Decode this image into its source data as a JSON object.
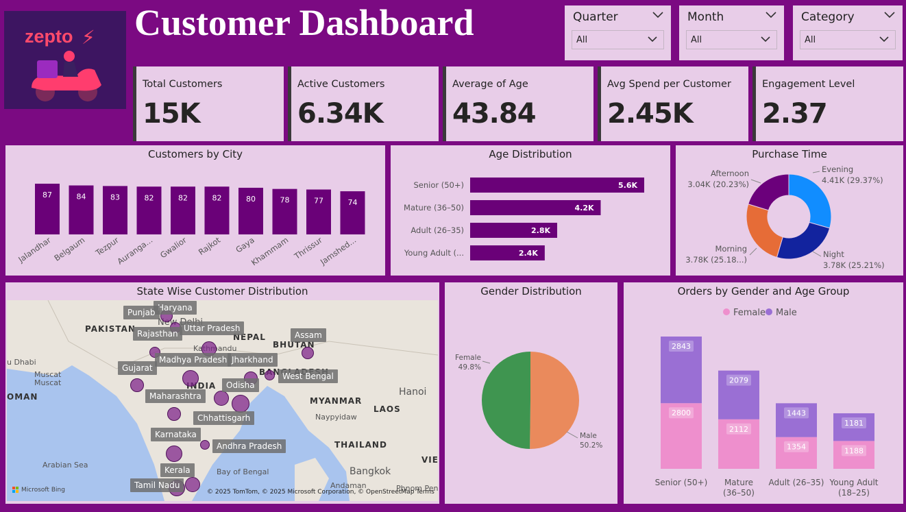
{
  "logo_text": "zepto",
  "title": "Customer Dashboard",
  "slicers": [
    {
      "label": "Quarter",
      "value": "All"
    },
    {
      "label": "Month",
      "value": "All"
    },
    {
      "label": "Category",
      "value": "All"
    }
  ],
  "kpis": [
    {
      "label": "Total Customers",
      "value": "15K"
    },
    {
      "label": "Active Customers",
      "value": "6.34K"
    },
    {
      "label": "Average of Age",
      "value": "43.84"
    },
    {
      "label": "Avg Spend per Customer",
      "value": "2.45K"
    },
    {
      "label": "Engagement Level",
      "value": "2.37"
    }
  ],
  "colors": {
    "bar": "#6a0178",
    "background": "#7b0a82",
    "panel": "#e8cde8",
    "female": "#ee8fcd",
    "male": "#9a6fd4"
  },
  "charts": {
    "city": {
      "title": "Customers by City"
    },
    "age": {
      "title": "Age Distribution"
    },
    "purchase": {
      "title": "Purchase Time"
    },
    "state": {
      "title": "State Wise Customer Distribution"
    },
    "gender": {
      "title": "Gender Distribution"
    },
    "orders": {
      "title": "Orders by Gender and Age Group"
    }
  },
  "chart_data": [
    {
      "type": "bar",
      "title": "Customers by City",
      "categories": [
        "Jalandhar",
        "Belgaum",
        "Tezpur",
        "Auranga...",
        "Gwalior",
        "Rajkot",
        "Gaya",
        "Khammam",
        "Thrissur",
        "Jamshed..."
      ],
      "values": [
        87,
        84,
        83,
        82,
        82,
        82,
        80,
        78,
        77,
        74
      ]
    },
    {
      "type": "bar",
      "orientation": "horizontal",
      "title": "Age Distribution",
      "categories": [
        "Senior (50+)",
        "Mature (36–50)",
        "Adult (26–35)",
        "Young Adult (..."
      ],
      "values": [
        5600,
        4200,
        2800,
        2400
      ],
      "labels": [
        "5.6K",
        "4.2K",
        "2.8K",
        "2.4K"
      ]
    },
    {
      "type": "pie",
      "donut": true,
      "title": "Purchase Time",
      "slices": [
        {
          "name": "Evening",
          "value": 4410,
          "label": "4.41K (29.37%)",
          "color": "#118dff"
        },
        {
          "name": "Night",
          "value": 3780,
          "label": "3.78K (25.21%)",
          "color": "#12239e"
        },
        {
          "name": "Morning",
          "value": 3780,
          "label": "3.78K (25.18...)",
          "color": "#e66c37"
        },
        {
          "name": "Afternoon",
          "value": 3040,
          "label": "3.04K (20.23%)",
          "color": "#6b007b"
        }
      ]
    },
    {
      "type": "pie",
      "title": "Gender Distribution",
      "slices": [
        {
          "name": "Male",
          "percent": 50.2,
          "label": "50.2%",
          "color": "#ea8a5c"
        },
        {
          "name": "Female",
          "percent": 49.8,
          "label": "49.8%",
          "color": "#3f9550"
        }
      ]
    },
    {
      "type": "bar",
      "stacked": true,
      "title": "Orders by Gender and Age Group",
      "categories": [
        "Senior (50+)",
        "Mature (36–50)",
        "Adult (26–35)",
        "Young Adult (18–25)"
      ],
      "category_lines": [
        [
          "Senior (50+)"
        ],
        [
          "Mature",
          "(36–50)"
        ],
        [
          "Adult (26–35)"
        ],
        [
          "Young Adult",
          "(18–25)"
        ]
      ],
      "series": [
        {
          "name": "Female",
          "values": [
            2800,
            2112,
            1354,
            1188
          ],
          "color": "#ee8fcd"
        },
        {
          "name": "Male",
          "values": [
            2843,
            2079,
            1443,
            1181
          ],
          "color": "#9a6fd4"
        }
      ],
      "legend": "top"
    }
  ],
  "map": {
    "states": [
      "Haryana",
      "Punjab",
      "Uttar Pradesh",
      "Rajasthan",
      "Assam",
      "Madhya Pradesh",
      "Jharkhand",
      "Gujarat",
      "West Bengal",
      "Odisha",
      "Maharashtra",
      "Chhattisgarh",
      "Karnataka",
      "Andhra Pradesh",
      "Kerala",
      "Tamil Nadu"
    ],
    "countries": [
      "PAKISTAN",
      "NEPAL",
      "BHUTAN",
      "INDIA",
      "BANGLADESH",
      "MYANMAR",
      "LAOS",
      "THAILAND",
      "OMAN",
      "VIE"
    ],
    "places": [
      "New Delhi",
      "Kathmandu",
      "u Dhabi",
      "Muscat",
      "Muscat",
      "Hanoi",
      "Naypyidaw",
      "Arabian Sea",
      "Bay of Bengal",
      "Bangkok",
      "Andaman",
      "Phnom Penh"
    ],
    "attribution": "© 2025 TomTom, © 2025 Microsoft Corporation, © OpenStreetMap  Terms",
    "bing": "Microsoft Bing"
  }
}
